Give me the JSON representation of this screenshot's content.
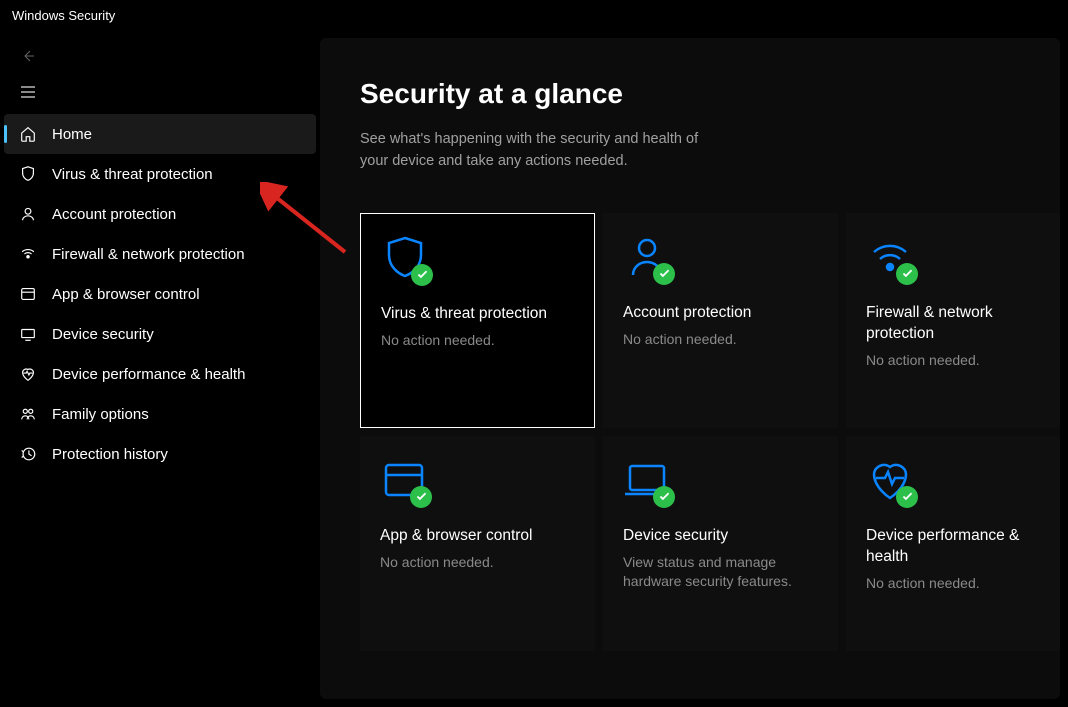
{
  "window": {
    "title": "Windows Security"
  },
  "sidebar": {
    "items": [
      {
        "id": "home",
        "label": "Home",
        "active": true
      },
      {
        "id": "virus-threat",
        "label": "Virus & threat protection",
        "active": false
      },
      {
        "id": "account",
        "label": "Account protection",
        "active": false
      },
      {
        "id": "firewall",
        "label": "Firewall & network protection",
        "active": false
      },
      {
        "id": "app-browser",
        "label": "App & browser control",
        "active": false
      },
      {
        "id": "device-security",
        "label": "Device security",
        "active": false
      },
      {
        "id": "device-performance",
        "label": "Device performance & health",
        "active": false
      },
      {
        "id": "family",
        "label": "Family options",
        "active": false
      },
      {
        "id": "history",
        "label": "Protection history",
        "active": false
      }
    ]
  },
  "main": {
    "title": "Security at a glance",
    "subtitle": "See what's happening with the security and health of your device and take any actions needed.",
    "tiles": [
      {
        "title": "Virus & threat protection",
        "status": "No action needed.",
        "selected": true
      },
      {
        "title": "Account protection",
        "status": "No action needed.",
        "selected": false
      },
      {
        "title": "Firewall & network protection",
        "status": "No action needed.",
        "selected": false
      },
      {
        "title": "App & browser control",
        "status": "No action needed.",
        "selected": false
      },
      {
        "title": "Device security",
        "status": "View status and manage hardware security features.",
        "selected": false
      },
      {
        "title": "Device performance & health",
        "status": "No action needed.",
        "selected": false
      }
    ]
  },
  "colors": {
    "accent": "#0078d4",
    "iconBlue": "#0a84ff",
    "success": "#2cc04b",
    "annotation": "#d9251f"
  }
}
